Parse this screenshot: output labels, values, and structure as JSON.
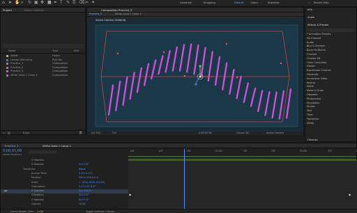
{
  "toolbar": {
    "workspaces": [
      "Default",
      "Learn",
      "Standard"
    ],
    "snapping": "Snapping",
    "universal": "Universal",
    "search_placeholder": "Search Help"
  },
  "project": {
    "tabs": [
      "Project",
      "Effect Controls"
    ],
    "columns": [
      "Name",
      "Type",
      "Size"
    ],
    "items": [
      {
        "name": "Solids",
        "type": "Folder",
        "size": "",
        "color": "#c8b24a"
      },
      {
        "name": "Lesson Whirlwing",
        "type": "PNG file",
        "size": "",
        "color": "#3d8b8b"
      },
      {
        "name": "Practice_1",
        "type": "Composition",
        "size": "",
        "color": "#b36fb3"
      },
      {
        "name": "Practice_2",
        "type": "Composition",
        "size": "",
        "color": "#b36fb3"
      },
      {
        "name": "Practice_3",
        "type": "Composition",
        "size": "",
        "color": "#b36fb3"
      },
      {
        "name": "White Solid 1 Comp 1",
        "type": "Composition",
        "size": "",
        "color": "#b36fb3"
      }
    ],
    "bpc": "8 bpc"
  },
  "composition": {
    "title": "Composition Practice_3",
    "tabs": [
      "Practice_3",
      "White Solid 1 Comp 1"
    ],
    "viewer_label": "Active Camera (Default)",
    "footer": {
      "zoom": "(61.5%)",
      "quality": "Full",
      "time": "0;00;01;06",
      "renderer": "Classic 3D",
      "camera": "Active Camera",
      "views": "1 View",
      "offset": "+0.0"
    }
  },
  "right_panel": {
    "info": "Info",
    "audio": "Audio",
    "effects_title": "Effects & Presets",
    "search_placeholder": "",
    "effects": [
      "* Animation Presets",
      "3D Channel",
      "Audio",
      "Blur & Sharpen",
      "Boris FX Mocha",
      "Channel",
      "Cinema 4D",
      "Color Correction",
      "Distort",
      "Expression Controls",
      "Generate",
      "Immersive Video",
      "Keying",
      "Matte",
      "Noise & Grain",
      "Obsolete",
      "Perspective",
      "Simulation",
      "Stylize",
      "Text",
      "Time",
      "Transition",
      "Utility"
    ],
    "libraries": "Libraries"
  },
  "timeline": {
    "tabs": [
      "Practice_3",
      "White Solid 1 Comp 1"
    ],
    "timecode": "0;00;01;06",
    "subcode": "00036 (30.00 fps)",
    "rows": [
      {
        "label": "X Rotation",
        "value": ""
      },
      {
        "label": "Z Rotation",
        "value": "0x+0.0°"
      },
      {
        "label": "Transform",
        "value": "Reset"
      },
      {
        "label": "Anchor Point",
        "value": "0.0,0.0,0.0"
      },
      {
        "label": "Position",
        "value": "960.0,540.0,0.0"
      },
      {
        "label": "Scale",
        "value": "∞ 1000,1000,100.0%"
      },
      {
        "label": "Orientation",
        "value": "0.0°,0.0°,0.0°"
      },
      {
        "label": "X Rotation",
        "value": "0x+224.0°"
      },
      {
        "label": "Y Rotation",
        "value": "0x+0.0°"
      },
      {
        "label": "Z Rotation",
        "value": "0x+0.0°"
      },
      {
        "label": "Opacity",
        "value": "100%"
      }
    ],
    "ruler": [
      "00f",
      "10f",
      "20f",
      "01:00f",
      "10f",
      "20f",
      "02:00f",
      "10f",
      "20f"
    ],
    "footer_left": "Frame Render Time",
    "render_time": "1.43s",
    "footer_toggle": "Toggle Switches / Modes"
  }
}
